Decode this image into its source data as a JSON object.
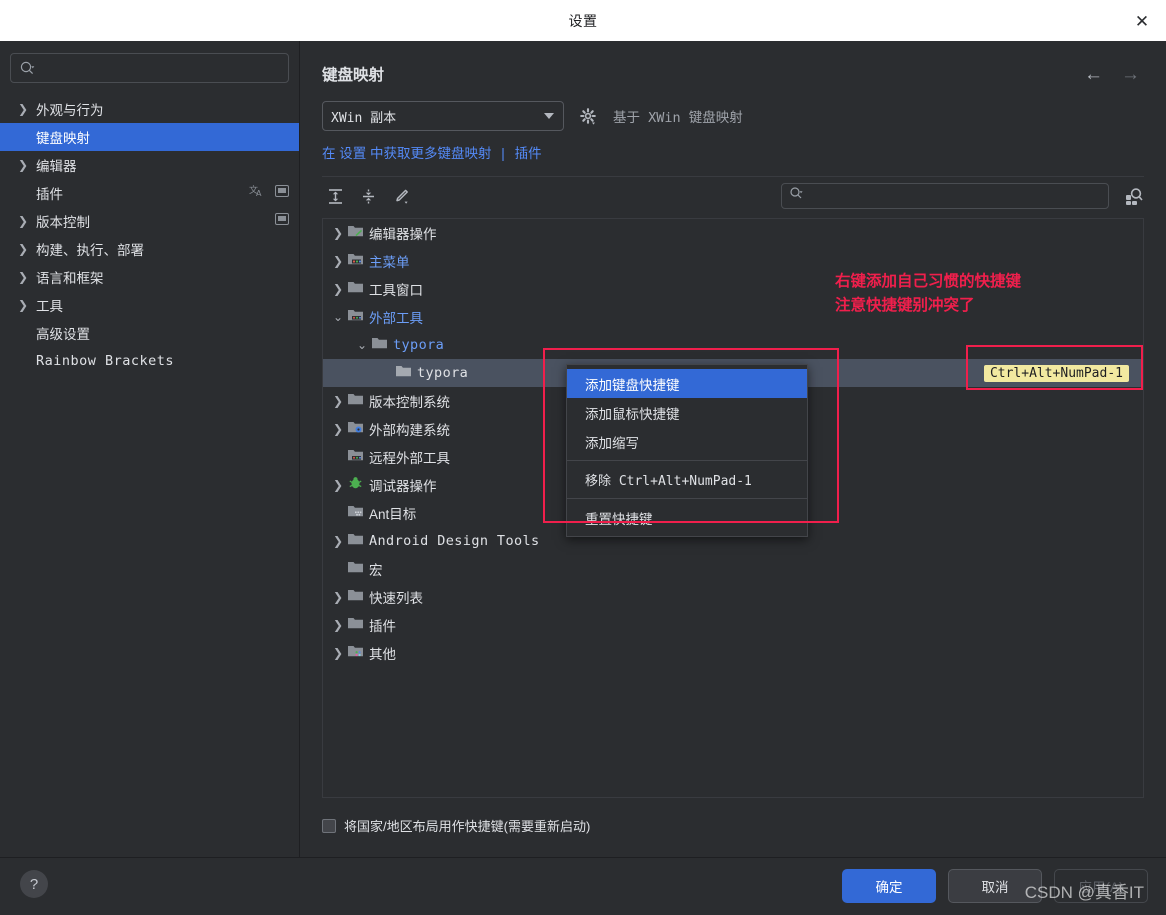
{
  "window": {
    "title": "设置",
    "close_icon": "close-icon"
  },
  "sidebar": {
    "search": {
      "placeholder": "",
      "value": "",
      "icon": "search-icon"
    },
    "items": [
      {
        "label": "外观与行为",
        "expandable": true,
        "selected": false,
        "mono": false
      },
      {
        "label": "键盘映射",
        "expandable": false,
        "selected": true,
        "mono": false
      },
      {
        "label": "编辑器",
        "expandable": true,
        "selected": false,
        "mono": false
      },
      {
        "label": "插件",
        "expandable": false,
        "selected": false,
        "mono": false,
        "badges": [
          "translate-icon",
          "plugin-badge-icon"
        ]
      },
      {
        "label": "版本控制",
        "expandable": true,
        "selected": false,
        "mono": false,
        "badges": [
          "plugin-badge-icon"
        ]
      },
      {
        "label": "构建、执行、部署",
        "expandable": true,
        "selected": false,
        "mono": false
      },
      {
        "label": "语言和框架",
        "expandable": true,
        "selected": false,
        "mono": false
      },
      {
        "label": "工具",
        "expandable": true,
        "selected": false,
        "mono": false
      },
      {
        "label": "高级设置",
        "expandable": false,
        "selected": false,
        "mono": false
      },
      {
        "label": "Rainbow Brackets",
        "expandable": false,
        "selected": false,
        "mono": true
      }
    ]
  },
  "main": {
    "title": "键盘映射",
    "back_arrow": "←",
    "forward_arrow": "→",
    "keymap_select": {
      "value": "XWin 副本"
    },
    "gear_icon": "gear-icon",
    "based_on": "基于 XWin 键盘映射",
    "links": {
      "prefix": "在",
      "settings": "设置",
      "middle": "中获取更多键盘映射",
      "separator": "|",
      "plugins": "插件"
    },
    "toolbar": {
      "expand_all": "expand-all-icon",
      "collapse_all": "collapse-all-icon",
      "edit": "edit-pencil-icon",
      "search": {
        "placeholder": "",
        "value": "",
        "icon": "search-icon"
      },
      "find_by_shortcut": "find-by-shortcut-icon"
    },
    "tree": [
      {
        "label": "编辑器操作",
        "indent": 0,
        "arrow": "collapsed",
        "icon": "folder-editor-icon",
        "color": "normal",
        "mono": false
      },
      {
        "label": "主菜单",
        "indent": 0,
        "arrow": "collapsed",
        "icon": "folder-menu-icon",
        "color": "blue",
        "mono": false
      },
      {
        "label": "工具窗口",
        "indent": 0,
        "arrow": "collapsed",
        "icon": "folder-icon",
        "color": "normal",
        "mono": false
      },
      {
        "label": "外部工具",
        "indent": 0,
        "arrow": "expanded",
        "icon": "folder-tools-icon",
        "color": "blue",
        "mono": false
      },
      {
        "label": "typora",
        "indent": 1,
        "arrow": "expanded",
        "icon": "folder-icon",
        "color": "blue",
        "mono": true
      },
      {
        "label": "typora",
        "indent": 2,
        "arrow": "none",
        "icon": "folder-icon",
        "color": "normal",
        "mono": true,
        "selected": true,
        "shortcut": "Ctrl+Alt+NumPad-1"
      },
      {
        "label": "版本控制系统",
        "indent": 0,
        "arrow": "collapsed",
        "icon": "folder-icon",
        "color": "normal",
        "mono": false
      },
      {
        "label": "外部构建系统",
        "indent": 0,
        "arrow": "collapsed",
        "icon": "folder-build-icon",
        "color": "normal",
        "mono": false
      },
      {
        "label": "远程外部工具",
        "indent": 0,
        "arrow": "none",
        "icon": "folder-tools-icon",
        "color": "normal",
        "mono": false
      },
      {
        "label": "调试器操作",
        "indent": 0,
        "arrow": "collapsed",
        "icon": "bug-icon",
        "color": "normal",
        "mono": false
      },
      {
        "label": "Ant目标",
        "indent": 0,
        "arrow": "none",
        "icon": "folder-ant-icon",
        "color": "normal",
        "mono": false
      },
      {
        "label": "Android Design Tools",
        "indent": 0,
        "arrow": "collapsed",
        "icon": "folder-icon",
        "color": "normal",
        "mono": true
      },
      {
        "label": "宏",
        "indent": 0,
        "arrow": "none",
        "icon": "folder-icon",
        "color": "normal",
        "mono": false
      },
      {
        "label": "快速列表",
        "indent": 0,
        "arrow": "collapsed",
        "icon": "folder-icon",
        "color": "normal",
        "mono": false
      },
      {
        "label": "插件",
        "indent": 0,
        "arrow": "collapsed",
        "icon": "folder-icon",
        "color": "normal",
        "mono": false
      },
      {
        "label": "其他",
        "indent": 0,
        "arrow": "collapsed",
        "icon": "folder-other-icon",
        "color": "normal",
        "mono": false
      }
    ],
    "checkbox": {
      "label": "将国家/地区布局用作快捷键(需要重新启动)",
      "checked": false
    }
  },
  "context_menu": {
    "items": [
      {
        "label": "添加键盘快捷键",
        "highlighted": true,
        "mono": false
      },
      {
        "label": "添加鼠标快捷键",
        "highlighted": false,
        "mono": false
      },
      {
        "label": "添加缩写",
        "highlighted": false,
        "mono": false
      },
      {
        "separator_before": true,
        "label": "移除 Ctrl+Alt+NumPad-1",
        "highlighted": false,
        "mono": true
      },
      {
        "separator_before": true,
        "label": "重置快捷键",
        "highlighted": false,
        "mono": false
      }
    ]
  },
  "annotations": {
    "note_text": "右键添加自己习惯的快捷键\n注意快捷键别冲突了",
    "note_color": "#f01f4c",
    "box_color": "#f01f4c"
  },
  "footer": {
    "help_label": "?",
    "ok_label": "确定",
    "cancel_label": "取消",
    "apply_label": "应用(A)"
  },
  "watermark": {
    "text": "CSDN @真香IT"
  },
  "colors": {
    "background": "#2b2d30",
    "accent_blue": "#3369d6",
    "link_blue": "#548af7",
    "selected_row": "#4a5260",
    "shortcut_highlight": "#f2e9a0",
    "annotation_red": "#f01f4c"
  }
}
